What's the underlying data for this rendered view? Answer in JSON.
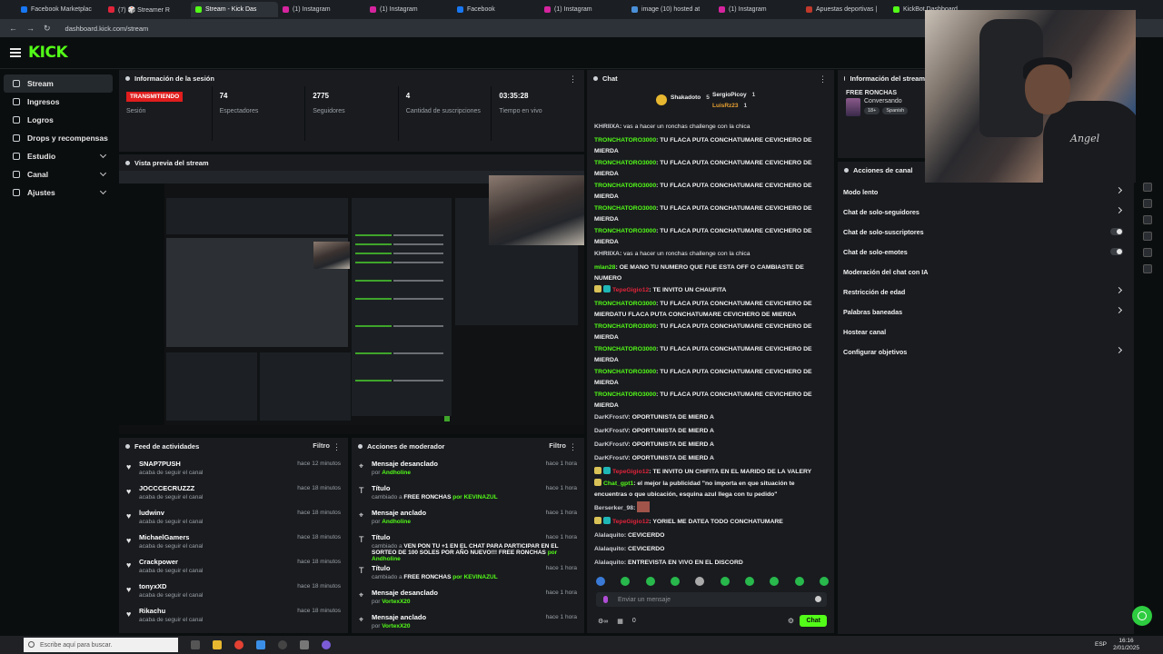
{
  "browser": {
    "tabs": [
      {
        "label": "Facebook Marketplac",
        "color": "#1877f2"
      },
      {
        "label": "(7) 🎲 Streamer R",
        "color": "#e0243a"
      },
      {
        "label": "Stream - Kick Das",
        "color": "#53fc18",
        "active": true
      },
      {
        "label": "(1) Instagram",
        "color": "#d6249f"
      },
      {
        "label": "(1) Instagram",
        "color": "#d6249f"
      },
      {
        "label": "Facebook",
        "color": "#1877f2"
      },
      {
        "label": "(1) Instagram",
        "color": "#d6249f"
      },
      {
        "label": "image (10) hosted at",
        "color": "#4a90d9"
      },
      {
        "label": "(1) Instagram",
        "color": "#d6249f"
      },
      {
        "label": "Apuestas deportivas |",
        "color": "#c0392b"
      },
      {
        "label": "KickBot Dashboard",
        "color": "#53fc18"
      }
    ],
    "url": "dashboard.kick.com/stream"
  },
  "brand": {
    "logo": "KICK",
    "accent": "#53fc18"
  },
  "sidebar": {
    "items": [
      {
        "label": "Stream",
        "active": true,
        "chevron": false
      },
      {
        "label": "Ingresos",
        "chevron": false
      },
      {
        "label": "Logros",
        "chevron": false
      },
      {
        "label": "Drops y recompensas",
        "chevron": false
      },
      {
        "label": "Estudio",
        "chevron": true
      },
      {
        "label": "Canal",
        "chevron": true
      },
      {
        "label": "Ajustes",
        "chevron": true
      }
    ]
  },
  "session": {
    "title": "Información de la sesión",
    "live_badge": "TRANSMITIENDO",
    "stats": [
      {
        "value": "",
        "label": "Sesión"
      },
      {
        "value": "74",
        "label": "Espectadores"
      },
      {
        "value": "2775",
        "label": "Seguidores"
      },
      {
        "value": "4",
        "label": "Cantidad de suscripciones"
      },
      {
        "value": "03:35:28",
        "label": "Tiempo en vivo"
      }
    ]
  },
  "preview": {
    "title": "Vista previa del stream"
  },
  "feed": {
    "title": "Feed de actividades",
    "filter": "Filtro",
    "items": [
      {
        "name": "SNAP7PUSH",
        "sub": "acaba de seguir el canal",
        "time": "hace 12 minutos"
      },
      {
        "name": "JOCCCECRUZZZ",
        "sub": "acaba de seguir el canal",
        "time": "hace 18 minutos"
      },
      {
        "name": "ludwinv",
        "sub": "acaba de seguir el canal",
        "time": "hace 18 minutos"
      },
      {
        "name": "MichaelGamers",
        "sub": "acaba de seguir el canal",
        "time": "hace 18 minutos"
      },
      {
        "name": "Crackpower",
        "sub": "acaba de seguir el canal",
        "time": "hace 18 minutos"
      },
      {
        "name": "tonyxXD",
        "sub": "acaba de seguir el canal",
        "time": "hace 18 minutos"
      },
      {
        "name": "Rikachu",
        "sub": "acaba de seguir el canal",
        "time": "hace 18 minutos"
      }
    ]
  },
  "mod": {
    "title": "Acciones de moderador",
    "filter": "Filtro",
    "items": [
      {
        "name": "Mensaje desanclado",
        "pre": "por ",
        "detail": "",
        "user": "Andholine",
        "time": "hace 1 hora"
      },
      {
        "name": "Título",
        "pre": "cambiado a ",
        "detail": "FREE RONCHAS",
        "user": " por KEVINAZUL",
        "time": "hace 1 hora"
      },
      {
        "name": "Mensaje anclado",
        "pre": "por ",
        "detail": "",
        "user": "Andholine",
        "time": "hace 1 hora"
      },
      {
        "name": "Título",
        "pre": "cambiado a ",
        "detail": "VEN PON TU +1 EN EL CHAT PARA PARTICIPAR EN EL SORTEO DE 100 SOLES POR AÑO NUEVO!!! FREE RONCHAS",
        "user": " por Andholine",
        "time": "hace 1 hora"
      },
      {
        "name": "Título",
        "pre": "cambiado a ",
        "detail": "FREE RONCHAS",
        "user": " por KEVINAZUL",
        "time": "hace 1 hora"
      },
      {
        "name": "Mensaje desanclado",
        "pre": "por ",
        "detail": "",
        "user": "VortexX20",
        "time": "hace 1 hora"
      },
      {
        "name": "Mensaje anclado",
        "pre": "por ",
        "detail": "",
        "user": "VortexX20",
        "time": "hace 1 hora"
      }
    ]
  },
  "chat": {
    "title": "Chat",
    "top_gifters": [
      {
        "name": "Shakadoto",
        "count": "5"
      },
      {
        "name": "SergioPicoy",
        "count": "1"
      },
      {
        "name": "LuisRz23",
        "count": "1"
      }
    ],
    "messages": [
      {
        "user": "KHRIIXA",
        "style": "dk",
        "text": "vas a hacer un ronchas challenge con la chica"
      },
      {
        "user": "TRONCHATORO3000",
        "style": "",
        "text": "TU FLACA PUTA CONCHATUMARE CEVICHERO DE MIERDA"
      },
      {
        "user": "TRONCHATORO3000",
        "style": "",
        "text": "TU FLACA PUTA CONCHATUMARE CEVICHERO DE MIERDA"
      },
      {
        "user": "TRONCHATORO3000",
        "style": "",
        "text": "TU FLACA PUTA CONCHATUMARE CEVICHERO DE MIERDA"
      },
      {
        "user": "TRONCHATORO3000",
        "style": "",
        "text": "TU FLACA PUTA CONCHATUMARE CEVICHERO DE MIERDA"
      },
      {
        "user": "TRONCHATORO3000",
        "style": "",
        "text": "TU FLACA PUTA CONCHATUMARE CEVICHERO DE MIERDA"
      },
      {
        "user": "KHRIIXA",
        "style": "dk",
        "text": "vas a hacer un ronchas challenge con la chica"
      },
      {
        "user": "mlan28",
        "style": "",
        "text": "OE MANO TU NUMERO QUE FUE ESTA OFF O CAMBIASTE DE NUMERO"
      },
      {
        "user": "TepeGigio12",
        "style": "red",
        "text": "TE INVITO UN CHAUFITA",
        "badges": 2
      },
      {
        "user": "TRONCHATORO3000",
        "style": "",
        "text": "TU FLACA PUTA CONCHATUMARE CEVICHERO DE MIERDATU FLACA PUTA CONCHATUMARE CEVICHERO DE MIERDA"
      },
      {
        "user": "TRONCHATORO3000",
        "style": "",
        "text": "TU FLACA PUTA CONCHATUMARE CEVICHERO DE MIERDA"
      },
      {
        "user": "TRONCHATORO3000",
        "style": "",
        "text": "TU FLACA PUTA CONCHATUMARE CEVICHERO DE MIERDA"
      },
      {
        "user": "TRONCHATORO3000",
        "style": "",
        "text": "TU FLACA PUTA CONCHATUMARE CEVICHERO DE MIERDA"
      },
      {
        "user": "TRONCHATORO3000",
        "style": "",
        "text": "TU FLACA PUTA CONCHATUMARE CEVICHERO DE MIERDA"
      },
      {
        "user": "DarKFrostV",
        "style": "dk",
        "text": "OPORTUNISTA DE MIERD A"
      },
      {
        "user": "DarKFrostV",
        "style": "dk",
        "text": "OPORTUNISTA DE MIERD A"
      },
      {
        "user": "DarKFrostV",
        "style": "dk",
        "text": "OPORTUNISTA DE MIERD A"
      },
      {
        "user": "DarKFrostV",
        "style": "dk",
        "text": "OPORTUNISTA DE MIERD A"
      },
      {
        "user": "TepeGigio12",
        "style": "red",
        "text": "TE INVITO UN CHIFITA EN EL MARIDO DE LA VALERY",
        "badges": 2
      },
      {
        "user": "Chat_gpt1",
        "style": "",
        "text": "el mejor la publicidad \"no importa en que situación te encuentras o que ubicación, esquina azul llega con tu pedido\"",
        "badges": 1
      },
      {
        "user": "Berserker_98",
        "style": "dk",
        "text": ""
      },
      {
        "user": "TepeGigio12",
        "style": "red",
        "text": "YORIEL ME DATEA TODO CONCHATUMARE",
        "badges": 2
      },
      {
        "user": "Alalaquito",
        "style": "dk",
        "text": "CEVICERDO"
      },
      {
        "user": "Alalaquito",
        "style": "dk",
        "text": "CEVICERDO"
      },
      {
        "user": "Alalaquito",
        "style": "dk",
        "text": "ENTREVISTA EN VIVO EN EL DISCORD"
      }
    ],
    "input_placeholder": "Enviar un mensaje",
    "viewer_count": "0",
    "send_label": "Chat"
  },
  "stream_info": {
    "title": "Información del stream",
    "stream_title": "FREE RONCHAS",
    "category": "Conversando",
    "tags": [
      "18+",
      "Spanish"
    ]
  },
  "actions": {
    "title": "Acciones de canal",
    "items": [
      {
        "label": "Modo lento",
        "control": "arrow"
      },
      {
        "label": "Chat de solo-seguidores",
        "control": "arrow"
      },
      {
        "label": "Chat de solo-suscriptores",
        "control": "toggle"
      },
      {
        "label": "Chat de solo-emotes",
        "control": "toggle"
      },
      {
        "label": "Moderación del chat con IA",
        "control": "none"
      },
      {
        "label": "Restricción de edad",
        "control": "arrow"
      },
      {
        "label": "Palabras baneadas",
        "control": "arrow"
      },
      {
        "label": "Hostear canal",
        "control": "none"
      },
      {
        "label": "Configurar objetivos",
        "control": "arrow"
      }
    ]
  },
  "webcam": {
    "shirt_text": "Angel"
  },
  "taskbar": {
    "search_placeholder": "Escribe aquí para buscar.",
    "lang": "ESP",
    "time": "16:16",
    "date": "2/01/2025"
  }
}
